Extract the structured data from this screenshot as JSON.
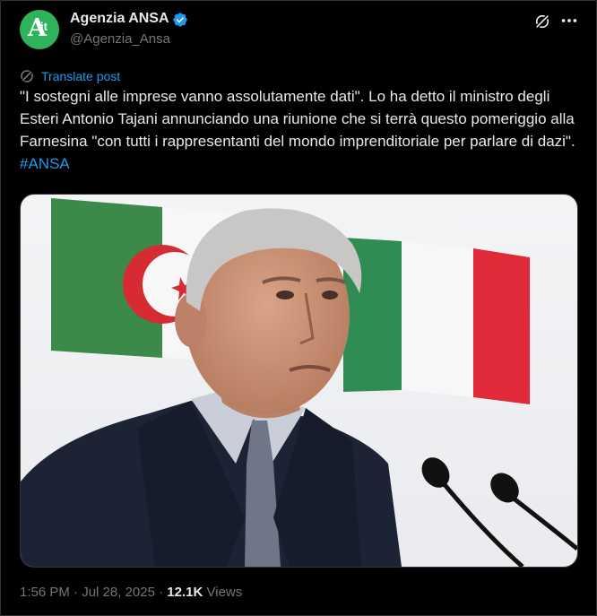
{
  "author": {
    "name": "Agenzia ANSA",
    "handle": "@Agenzia_Ansa",
    "avatar_letter": "A",
    "avatar_suffix": "it",
    "verified": true,
    "verified_icon": "verified-badge-icon"
  },
  "actions": {
    "grok_icon": "grok-icon",
    "more_icon": "more-icon"
  },
  "translate": {
    "label": "Translate post",
    "icon": "translate-icon"
  },
  "post": {
    "text": "\"I sostegni alle imprese vanno assolutamente dati\". Lo ha detto il ministro degli Esteri Antonio Tajani annunciando una riunione che si terrà questo pomeriggio alla Farnesina \"con tutti i rappresentanti del mondo imprenditoriale per parlare di dazi\". ",
    "hashtag": "#ANSA"
  },
  "meta": {
    "time": "1:56 PM",
    "separator": "·",
    "date": "Jul 28, 2025",
    "views_count": "12.1K",
    "views_label": "Views"
  },
  "colors": {
    "background": "#000000",
    "text": "#e7e9ea",
    "muted": "#71767b",
    "link": "#1d9bf0",
    "avatar": "#2fb35a",
    "border": "#2f3336"
  }
}
